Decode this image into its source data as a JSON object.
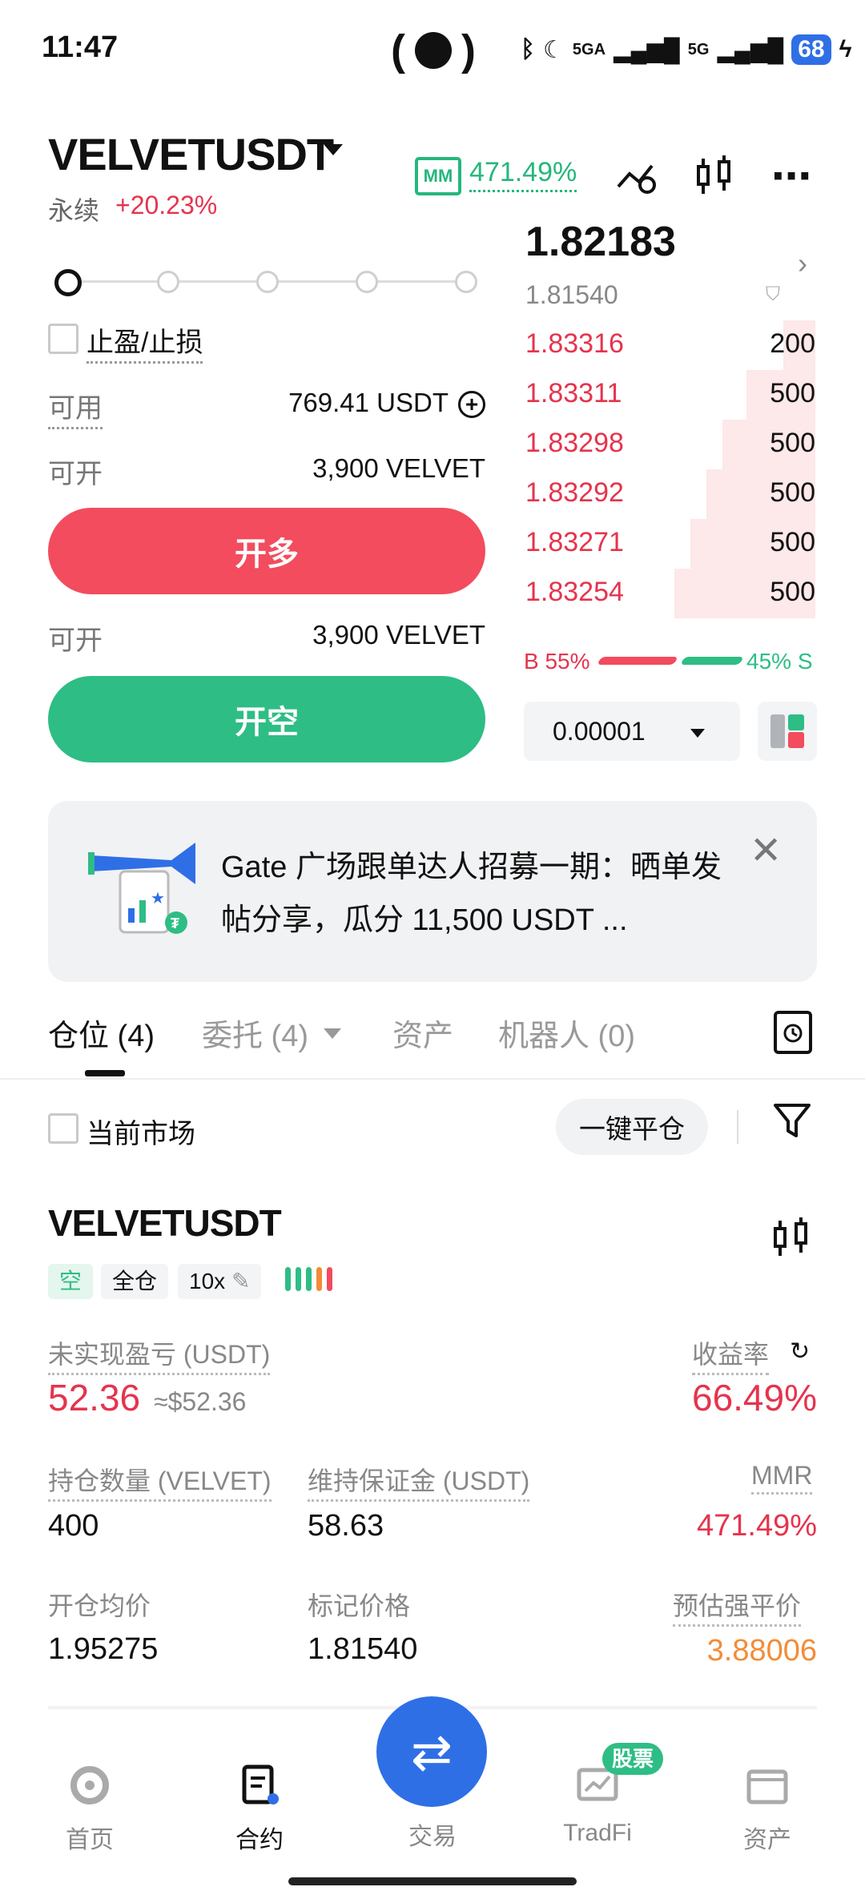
{
  "status_bar": {
    "time": "11:47",
    "network_1": "5GA",
    "network_2": "5G",
    "battery": "68"
  },
  "header": {
    "pair": "VELVETUSDT",
    "contract_type": "永续",
    "change": "+20.23%",
    "mm_label": "MM",
    "mm_value": "471.49%"
  },
  "order_form": {
    "tpsl_label": "止盈/止损",
    "available_label": "可用",
    "available_value": "769.41 USDT",
    "can_open_label": "可开",
    "can_open_long_value": "3,900 VELVET",
    "long_button": "开多",
    "can_open_short_value": "3,900 VELVET",
    "short_button": "开空"
  },
  "order_book": {
    "last_price": "1.82183",
    "mark_price": "1.81540",
    "asks": [
      {
        "price": "1.83316",
        "qty": "200"
      },
      {
        "price": "1.83311",
        "qty": "500"
      },
      {
        "price": "1.83298",
        "qty": "500"
      },
      {
        "price": "1.83292",
        "qty": "500"
      },
      {
        "price": "1.83271",
        "qty": "500"
      },
      {
        "price": "1.83254",
        "qty": "500"
      }
    ],
    "buy_ratio": "B 55%",
    "sell_ratio": "45% S",
    "precision": "0.00001"
  },
  "banner": {
    "text": "Gate 广场跟单达人招募一期：晒单发帖分享，瓜分 11,500 USDT ..."
  },
  "tabs": {
    "positions": "仓位 (4)",
    "orders": "委托 (4)",
    "assets": "资产",
    "bots": "机器人 (0)"
  },
  "filters": {
    "current_market": "当前市场",
    "close_all": "一键平仓"
  },
  "position": {
    "symbol": "VELVETUSDT",
    "side": "空",
    "margin_mode": "全仓",
    "leverage": "10x",
    "pnl_label": "未实现盈亏 (USDT)",
    "pnl_value": "52.36",
    "pnl_usd": "≈$52.36",
    "roe_label": "收益率",
    "roe_value": "66.49%",
    "size_label": "持仓数量 (VELVET)",
    "size_value": "400",
    "margin_label": "维持保证金 (USDT)",
    "margin_value": "58.63",
    "mmr_label": "MMR",
    "mmr_value": "471.49%",
    "entry_label": "开仓均价",
    "entry_value": "1.95275",
    "mark_label": "标记价格",
    "mark_value": "1.81540",
    "liq_label": "预估强平价",
    "liq_value": "3.88006"
  },
  "bottom_nav": {
    "home": "首页",
    "futures": "合约",
    "trade": "交易",
    "tradfi": "TradFi",
    "tradfi_badge": "股票",
    "assets": "资产"
  }
}
